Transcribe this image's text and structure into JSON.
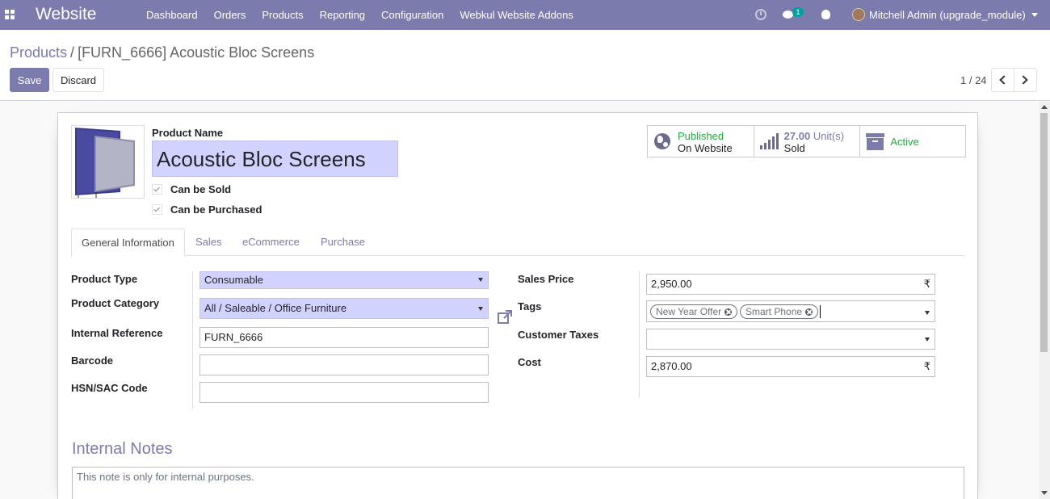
{
  "navbar": {
    "app_name": "Website",
    "menu": [
      "Dashboard",
      "Orders",
      "Products",
      "Reporting",
      "Configuration",
      "Webkul Website Addons"
    ],
    "chat_badge": "1",
    "user": "Mitchell Admin (upgrade_module)",
    "color": "#7c7bad"
  },
  "breadcrumb": {
    "parent": "Products",
    "separator": "/",
    "current": "[FURN_6666] Acoustic Bloc Screens"
  },
  "buttons": {
    "save": "Save",
    "discard": "Discard"
  },
  "pager": {
    "value": "1 / 24"
  },
  "product": {
    "name_label": "Product Name",
    "name": "Acoustic Bloc Screens",
    "can_be_sold_label": "Can be Sold",
    "can_be_sold": true,
    "can_be_purchased_label": "Can be Purchased",
    "can_be_purchased": true
  },
  "smart_buttons": {
    "published_line1": "Published",
    "published_line2": "On Website",
    "sold_value": "27.00",
    "sold_unit": "Unit(s)",
    "sold_label": "Sold",
    "active_label": "Active"
  },
  "tabs": [
    "General Information",
    "Sales",
    "eCommerce",
    "Purchase"
  ],
  "left_fields": {
    "product_type_label": "Product Type",
    "product_type": "Consumable",
    "category_label": "Product Category",
    "category": "All / Saleable / Office Furniture",
    "internal_ref_label": "Internal Reference",
    "internal_ref": "FURN_6666",
    "barcode_label": "Barcode",
    "barcode": "",
    "hsn_label": "HSN/SAC Code",
    "hsn": ""
  },
  "right_fields": {
    "sales_price_label": "Sales Price",
    "sales_price": "2,950.00",
    "currency": "₹",
    "tags_label": "Tags",
    "tags": [
      "New Year Offer",
      "Smart Phone"
    ],
    "customer_taxes_label": "Customer Taxes",
    "customer_taxes": "",
    "cost_label": "Cost",
    "cost": "2,870.00"
  },
  "notes": {
    "title": "Internal Notes",
    "placeholder": "This note is only for internal purposes."
  }
}
